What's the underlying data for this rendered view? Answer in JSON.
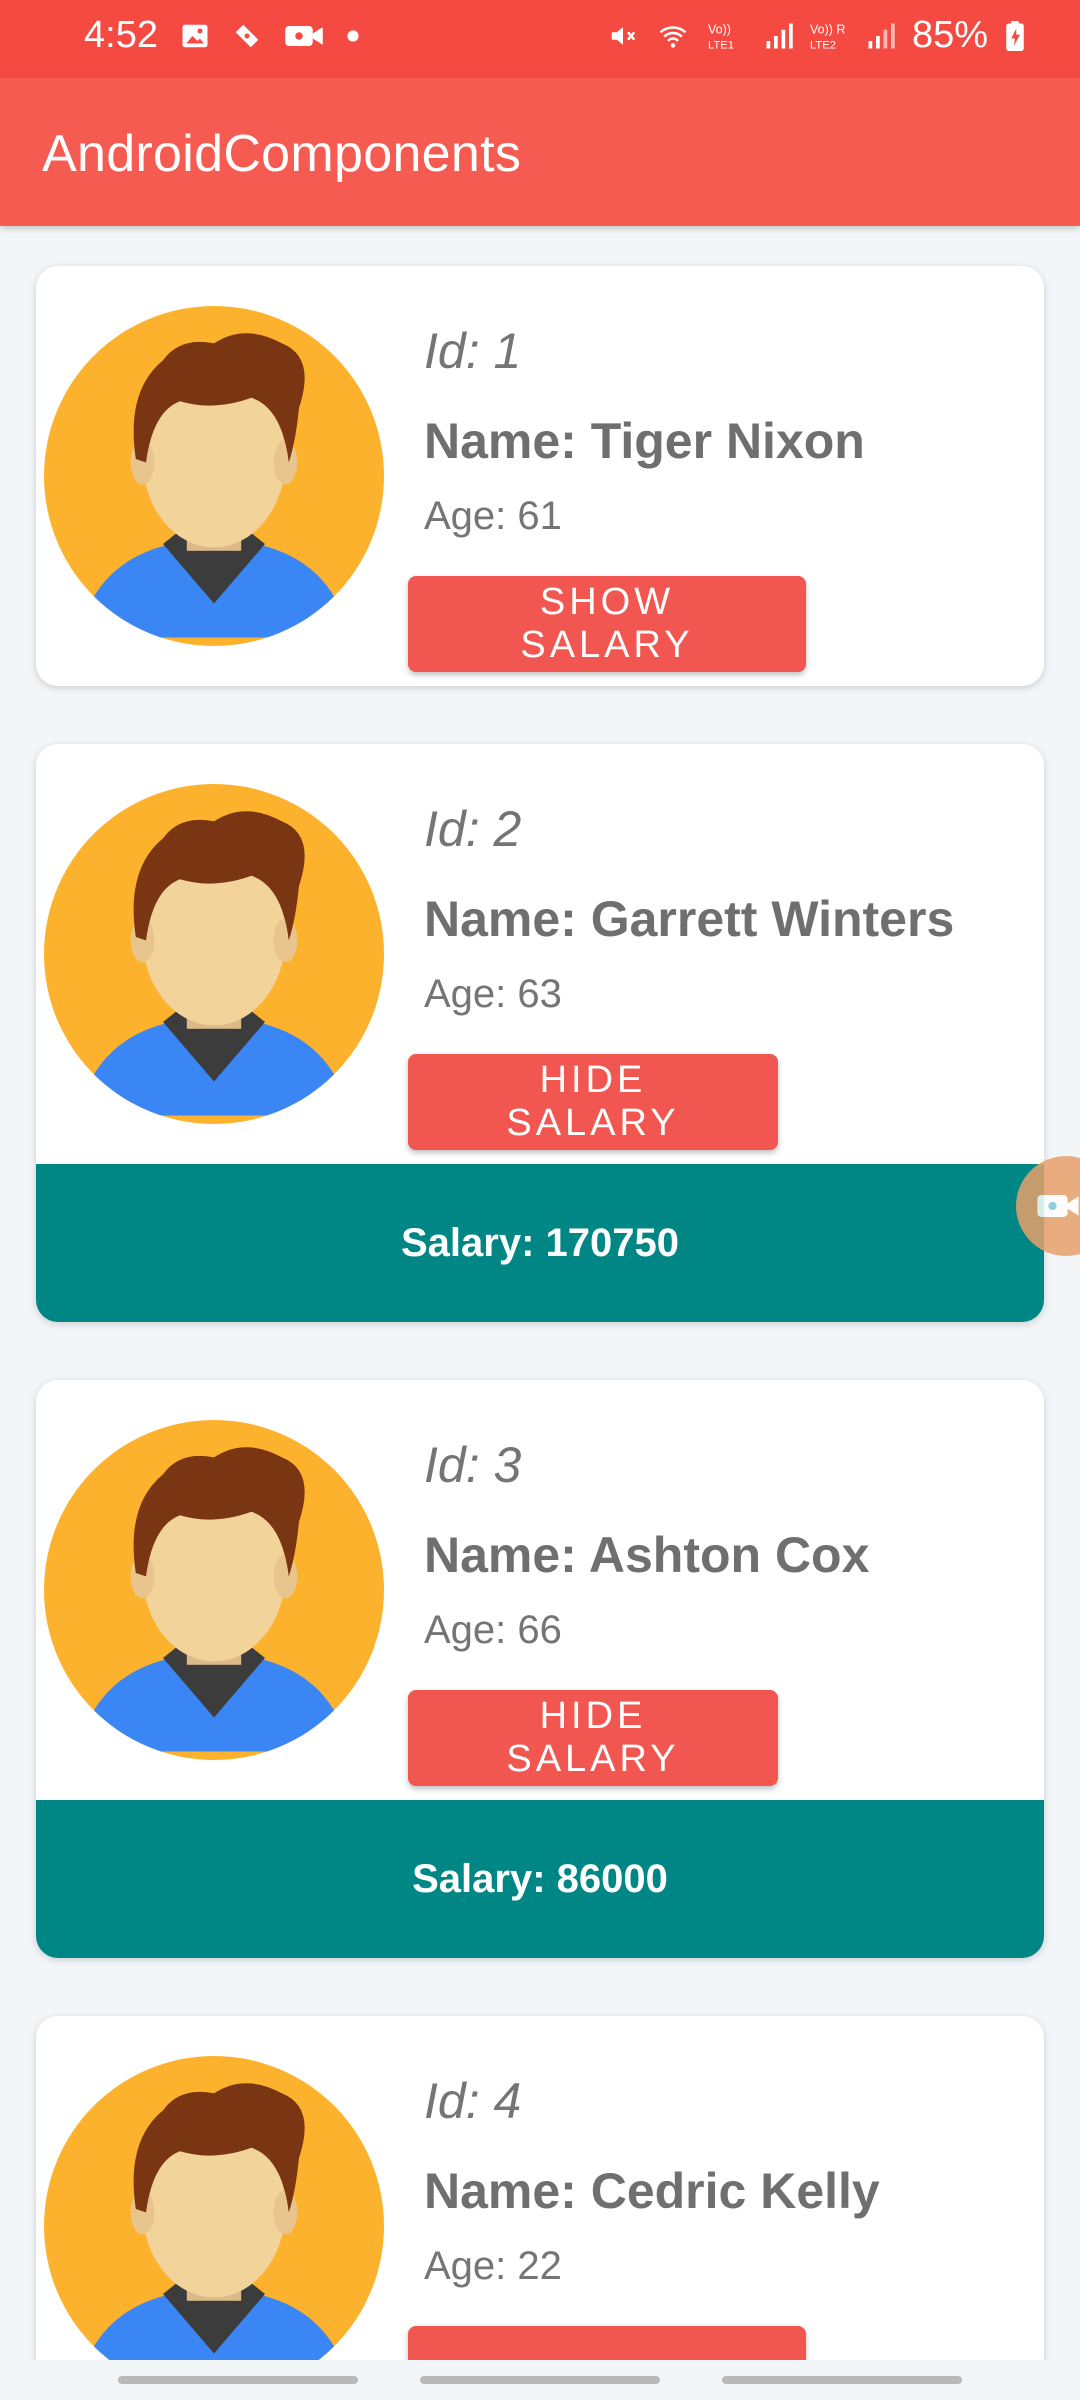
{
  "status_bar": {
    "time": "4:52",
    "battery": "85%",
    "left_icons": [
      "gallery-icon",
      "ticket-icon",
      "video-camera-icon",
      "dot-icon"
    ],
    "right_icons": [
      "mute-icon",
      "wifi-icon",
      "volte-lte1-icon",
      "signal-icon",
      "volte-lte2-icon",
      "signal-roaming-icon",
      "battery-charging-icon"
    ]
  },
  "app_bar": {
    "title": "AndroidComponents"
  },
  "employees": [
    {
      "id_label": "Id: 1",
      "name_label": "Name: Tiger Nixon",
      "age_label": "Age: 61",
      "button_label": "SHOW SALARY",
      "salary_label": ""
    },
    {
      "id_label": "Id: 2",
      "name_label": "Name: Garrett Winters",
      "age_label": "Age: 63",
      "button_label": "HIDE SALARY",
      "salary_label": "Salary: 170750"
    },
    {
      "id_label": "Id: 3",
      "name_label": "Name: Ashton Cox",
      "age_label": "Age: 66",
      "button_label": "HIDE SALARY",
      "salary_label": "Salary: 86000"
    },
    {
      "id_label": "Id: 4",
      "name_label": "Name: Cedric Kelly",
      "age_label": "Age: 22",
      "button_label": "",
      "salary_label": ""
    }
  ],
  "colors": {
    "status_bar": "#f44a41",
    "app_bar": "#f55b51",
    "button": "#f25650",
    "salary_bar": "#008785",
    "background": "#f3f6f8"
  }
}
